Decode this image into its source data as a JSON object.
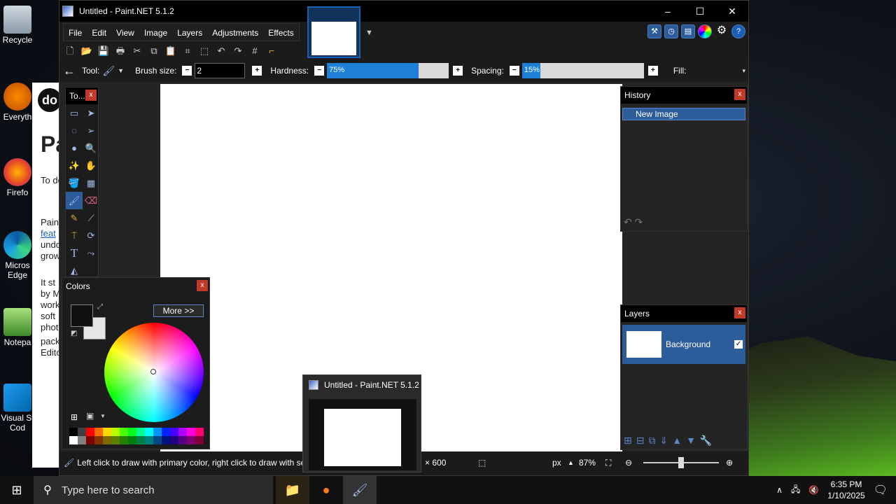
{
  "desktop": {
    "icons": [
      {
        "label": "Recycle"
      },
      {
        "label": "Everyth"
      },
      {
        "label": "Firefo"
      },
      {
        "label": "Micros Edge"
      },
      {
        "label": "Notepa"
      },
      {
        "label": "Visual St Cod"
      }
    ]
  },
  "browser": {
    "logo_text": "do",
    "heading": "Pa",
    "lines": [
      "To do",
      "Pain",
      "feat",
      "undo",
      "grow",
      "It st",
      "by M",
      "work",
      "soft",
      "phot",
      "pack",
      "Edito"
    ]
  },
  "window": {
    "title": "Untitled - Paint.NET 5.1.2",
    "controls": {
      "minimize": "–",
      "maximize": "☐",
      "close": "✕"
    }
  },
  "menu": [
    "File",
    "Edit",
    "View",
    "Image",
    "Layers",
    "Adjustments",
    "Effects"
  ],
  "toolbar": {
    "tool_label": "Tool:",
    "brush_size_label": "Brush size:",
    "brush_size_value": "2",
    "hardness_label": "Hardness:",
    "hardness_value": "75%",
    "hardness_fraction": 0.75,
    "spacing_label": "Spacing:",
    "spacing_value": "15%",
    "spacing_fraction": 0.15,
    "fill_label": "Fill:"
  },
  "panels": {
    "tools_title": "To...",
    "colors_title": "Colors",
    "more_button": "More >>",
    "history_title": "History",
    "history_items": [
      "New Image"
    ],
    "layers_title": "Layers",
    "layers": [
      {
        "name": "Background",
        "visible": true
      }
    ]
  },
  "status": {
    "hint": "Left click to draw with primary color, right click to draw with se",
    "size_fragment": "× 600",
    "unit": "px",
    "zoom": "87%"
  },
  "preview": {
    "title": "Untitled - Paint.NET 5.1.2"
  },
  "taskbar": {
    "search_placeholder": "Type here to search",
    "time": "6:35 PM",
    "date": "1/10/2025"
  },
  "colors": {
    "accent": "#2d5c9a",
    "primary": "#111111",
    "secondary": "#e6e6e6",
    "palette": [
      "#000000",
      "#404040",
      "#ff0000",
      "#ff6a00",
      "#ffd800",
      "#b6ff00",
      "#4cff00",
      "#00ff21",
      "#00ff90",
      "#00ffff",
      "#0094ff",
      "#0026ff",
      "#4800ff",
      "#b200ff",
      "#ff00dc",
      "#ff006e",
      "#ffffff",
      "#808080",
      "#7f0000",
      "#7f3300",
      "#7f6a00",
      "#5b7f00",
      "#267f00",
      "#007f0e",
      "#007f46",
      "#007f7f",
      "#004a7f",
      "#00137f",
      "#21007f",
      "#57007f",
      "#7f006e",
      "#7f0037"
    ]
  }
}
